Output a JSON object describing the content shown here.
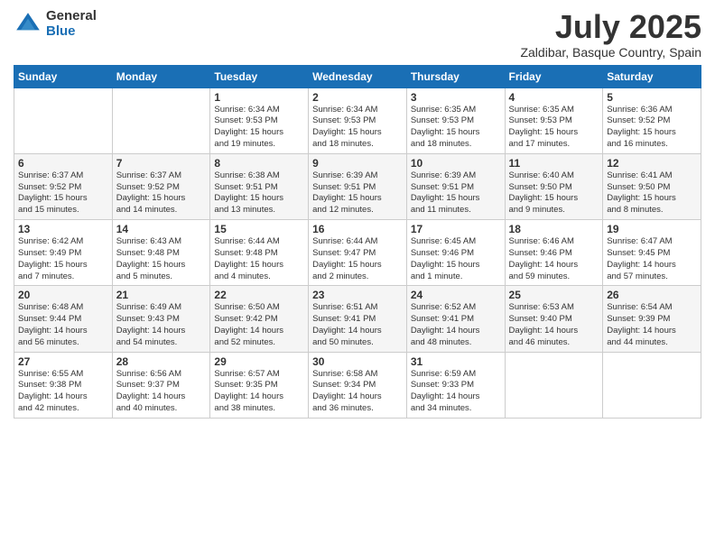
{
  "logo": {
    "general": "General",
    "blue": "Blue"
  },
  "title": {
    "month": "July 2025",
    "location": "Zaldibar, Basque Country, Spain"
  },
  "days_of_week": [
    "Sunday",
    "Monday",
    "Tuesday",
    "Wednesday",
    "Thursday",
    "Friday",
    "Saturday"
  ],
  "weeks": [
    [
      {
        "num": "",
        "info": ""
      },
      {
        "num": "",
        "info": ""
      },
      {
        "num": "1",
        "info": "Sunrise: 6:34 AM\nSunset: 9:53 PM\nDaylight: 15 hours\nand 19 minutes."
      },
      {
        "num": "2",
        "info": "Sunrise: 6:34 AM\nSunset: 9:53 PM\nDaylight: 15 hours\nand 18 minutes."
      },
      {
        "num": "3",
        "info": "Sunrise: 6:35 AM\nSunset: 9:53 PM\nDaylight: 15 hours\nand 18 minutes."
      },
      {
        "num": "4",
        "info": "Sunrise: 6:35 AM\nSunset: 9:53 PM\nDaylight: 15 hours\nand 17 minutes."
      },
      {
        "num": "5",
        "info": "Sunrise: 6:36 AM\nSunset: 9:52 PM\nDaylight: 15 hours\nand 16 minutes."
      }
    ],
    [
      {
        "num": "6",
        "info": "Sunrise: 6:37 AM\nSunset: 9:52 PM\nDaylight: 15 hours\nand 15 minutes."
      },
      {
        "num": "7",
        "info": "Sunrise: 6:37 AM\nSunset: 9:52 PM\nDaylight: 15 hours\nand 14 minutes."
      },
      {
        "num": "8",
        "info": "Sunrise: 6:38 AM\nSunset: 9:51 PM\nDaylight: 15 hours\nand 13 minutes."
      },
      {
        "num": "9",
        "info": "Sunrise: 6:39 AM\nSunset: 9:51 PM\nDaylight: 15 hours\nand 12 minutes."
      },
      {
        "num": "10",
        "info": "Sunrise: 6:39 AM\nSunset: 9:51 PM\nDaylight: 15 hours\nand 11 minutes."
      },
      {
        "num": "11",
        "info": "Sunrise: 6:40 AM\nSunset: 9:50 PM\nDaylight: 15 hours\nand 9 minutes."
      },
      {
        "num": "12",
        "info": "Sunrise: 6:41 AM\nSunset: 9:50 PM\nDaylight: 15 hours\nand 8 minutes."
      }
    ],
    [
      {
        "num": "13",
        "info": "Sunrise: 6:42 AM\nSunset: 9:49 PM\nDaylight: 15 hours\nand 7 minutes."
      },
      {
        "num": "14",
        "info": "Sunrise: 6:43 AM\nSunset: 9:48 PM\nDaylight: 15 hours\nand 5 minutes."
      },
      {
        "num": "15",
        "info": "Sunrise: 6:44 AM\nSunset: 9:48 PM\nDaylight: 15 hours\nand 4 minutes."
      },
      {
        "num": "16",
        "info": "Sunrise: 6:44 AM\nSunset: 9:47 PM\nDaylight: 15 hours\nand 2 minutes."
      },
      {
        "num": "17",
        "info": "Sunrise: 6:45 AM\nSunset: 9:46 PM\nDaylight: 15 hours\nand 1 minute."
      },
      {
        "num": "18",
        "info": "Sunrise: 6:46 AM\nSunset: 9:46 PM\nDaylight: 14 hours\nand 59 minutes."
      },
      {
        "num": "19",
        "info": "Sunrise: 6:47 AM\nSunset: 9:45 PM\nDaylight: 14 hours\nand 57 minutes."
      }
    ],
    [
      {
        "num": "20",
        "info": "Sunrise: 6:48 AM\nSunset: 9:44 PM\nDaylight: 14 hours\nand 56 minutes."
      },
      {
        "num": "21",
        "info": "Sunrise: 6:49 AM\nSunset: 9:43 PM\nDaylight: 14 hours\nand 54 minutes."
      },
      {
        "num": "22",
        "info": "Sunrise: 6:50 AM\nSunset: 9:42 PM\nDaylight: 14 hours\nand 52 minutes."
      },
      {
        "num": "23",
        "info": "Sunrise: 6:51 AM\nSunset: 9:41 PM\nDaylight: 14 hours\nand 50 minutes."
      },
      {
        "num": "24",
        "info": "Sunrise: 6:52 AM\nSunset: 9:41 PM\nDaylight: 14 hours\nand 48 minutes."
      },
      {
        "num": "25",
        "info": "Sunrise: 6:53 AM\nSunset: 9:40 PM\nDaylight: 14 hours\nand 46 minutes."
      },
      {
        "num": "26",
        "info": "Sunrise: 6:54 AM\nSunset: 9:39 PM\nDaylight: 14 hours\nand 44 minutes."
      }
    ],
    [
      {
        "num": "27",
        "info": "Sunrise: 6:55 AM\nSunset: 9:38 PM\nDaylight: 14 hours\nand 42 minutes."
      },
      {
        "num": "28",
        "info": "Sunrise: 6:56 AM\nSunset: 9:37 PM\nDaylight: 14 hours\nand 40 minutes."
      },
      {
        "num": "29",
        "info": "Sunrise: 6:57 AM\nSunset: 9:35 PM\nDaylight: 14 hours\nand 38 minutes."
      },
      {
        "num": "30",
        "info": "Sunrise: 6:58 AM\nSunset: 9:34 PM\nDaylight: 14 hours\nand 36 minutes."
      },
      {
        "num": "31",
        "info": "Sunrise: 6:59 AM\nSunset: 9:33 PM\nDaylight: 14 hours\nand 34 minutes."
      },
      {
        "num": "",
        "info": ""
      },
      {
        "num": "",
        "info": ""
      }
    ]
  ]
}
